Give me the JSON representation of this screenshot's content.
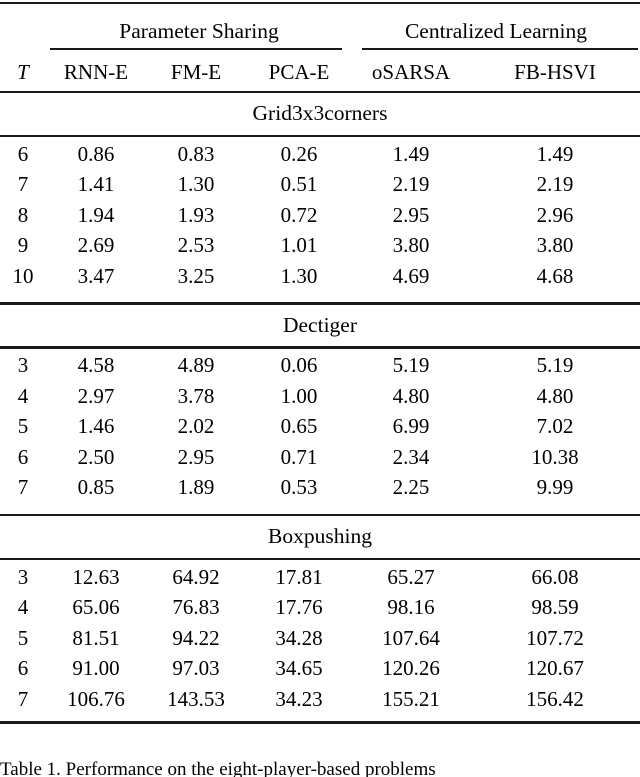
{
  "table": {
    "group_headers": [
      {
        "label": "Parameter Sharing",
        "span": 3
      },
      {
        "label": "Centralized Learning",
        "span": 2
      }
    ],
    "columns": [
      "T",
      "RNN-E",
      "FM-E",
      "PCA-E",
      "oSARSA",
      "FB-HSVI"
    ],
    "sections": [
      {
        "name": "Grid3x3corners",
        "rows": [
          {
            "T": "6",
            "RNN-E": "0.86",
            "FM-E": "0.83",
            "PCA-E": "0.26",
            "oSARSA": "1.49",
            "FB-HSVI": "1.49"
          },
          {
            "T": "7",
            "RNN-E": "1.41",
            "FM-E": "1.30",
            "PCA-E": "0.51",
            "oSARSA": "2.19",
            "FB-HSVI": "2.19"
          },
          {
            "T": "8",
            "RNN-E": "1.94",
            "FM-E": "1.93",
            "PCA-E": "0.72",
            "oSARSA": "2.95",
            "FB-HSVI": "2.96"
          },
          {
            "T": "9",
            "RNN-E": "2.69",
            "FM-E": "2.53",
            "PCA-E": "1.01",
            "oSARSA": "3.80",
            "FB-HSVI": "3.80"
          },
          {
            "T": "10",
            "RNN-E": "3.47",
            "FM-E": "3.25",
            "PCA-E": "1.30",
            "oSARSA": "4.69",
            "FB-HSVI": "4.68"
          }
        ]
      },
      {
        "name": "Dectiger",
        "rows": [
          {
            "T": "3",
            "RNN-E": "4.58",
            "FM-E": "4.89",
            "PCA-E": "0.06",
            "oSARSA": "5.19",
            "FB-HSVI": "5.19"
          },
          {
            "T": "4",
            "RNN-E": "2.97",
            "FM-E": "3.78",
            "PCA-E": "1.00",
            "oSARSA": "4.80",
            "FB-HSVI": "4.80"
          },
          {
            "T": "5",
            "RNN-E": "1.46",
            "FM-E": "2.02",
            "PCA-E": "0.65",
            "oSARSA": "6.99",
            "FB-HSVI": "7.02"
          },
          {
            "T": "6",
            "RNN-E": "2.50",
            "FM-E": "2.95",
            "PCA-E": "0.71",
            "oSARSA": "2.34",
            "FB-HSVI": "10.38"
          },
          {
            "T": "7",
            "RNN-E": "0.85",
            "FM-E": "1.89",
            "PCA-E": "0.53",
            "oSARSA": "2.25",
            "FB-HSVI": "9.99"
          }
        ]
      },
      {
        "name": "Boxpushing",
        "rows": [
          {
            "T": "3",
            "RNN-E": "12.63",
            "FM-E": "64.92",
            "PCA-E": "17.81",
            "oSARSA": "65.27",
            "FB-HSVI": "66.08"
          },
          {
            "T": "4",
            "RNN-E": "65.06",
            "FM-E": "76.83",
            "PCA-E": "17.76",
            "oSARSA": "98.16",
            "FB-HSVI": "98.59"
          },
          {
            "T": "5",
            "RNN-E": "81.51",
            "FM-E": "94.22",
            "PCA-E": "34.28",
            "oSARSA": "107.64",
            "FB-HSVI": "107.72"
          },
          {
            "T": "6",
            "RNN-E": "91.00",
            "FM-E": "97.03",
            "PCA-E": "34.65",
            "oSARSA": "120.26",
            "FB-HSVI": "120.67"
          },
          {
            "T": "7",
            "RNN-E": "106.76",
            "FM-E": "143.53",
            "PCA-E": "34.23",
            "oSARSA": "155.21",
            "FB-HSVI": "156.42"
          }
        ]
      }
    ]
  },
  "caption": {
    "text": "Table 1. Performance on the eight-player-based problems"
  },
  "colors": {
    "rule": "#1a1a1a",
    "text": "#000000",
    "background": "#ffffff"
  }
}
